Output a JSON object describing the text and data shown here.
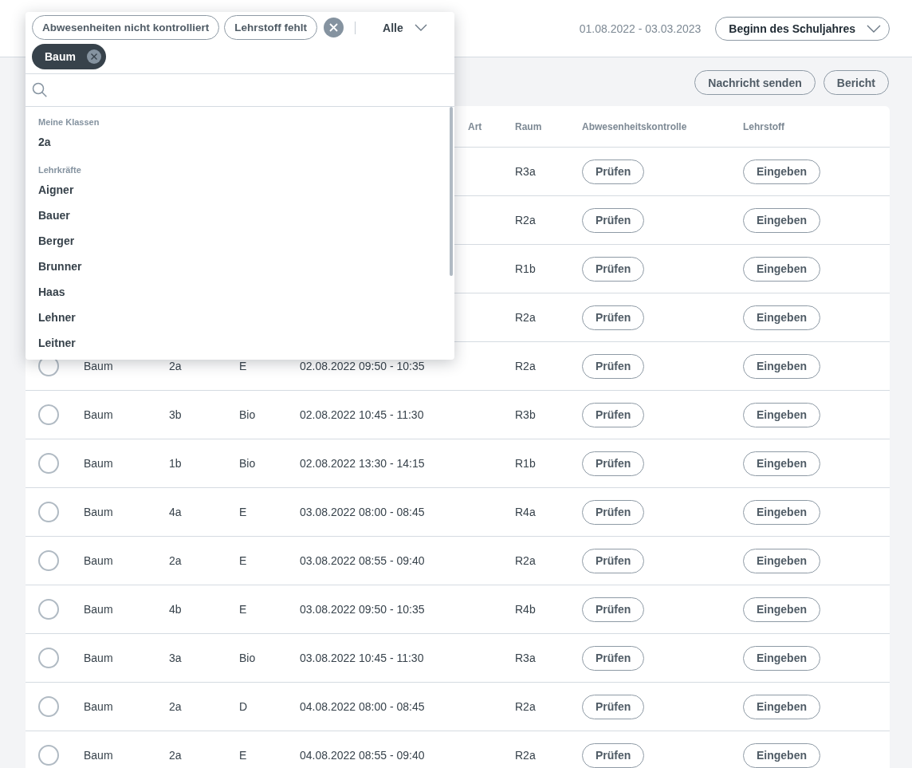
{
  "header": {
    "date_range": "01.08.2022 - 03.03.2023",
    "period_select": "Beginn des Schuljahres"
  },
  "actions": [
    "Nachricht senden",
    "Bericht"
  ],
  "filter_popup": {
    "chips": [
      {
        "label": "Abwesenheiten nicht kontrolliert",
        "selected": false
      },
      {
        "label": "Lehrstoff fehlt",
        "selected": false
      }
    ],
    "scope_select": "Alle",
    "tags": [
      {
        "label": "Baum"
      }
    ],
    "groups": [
      {
        "heading": "Meine Klassen",
        "items": [
          "2a"
        ]
      },
      {
        "heading": "Lehrkräfte",
        "items": [
          "Aigner",
          "Bauer",
          "Berger",
          "Brunner",
          "Haas",
          "Lehner",
          "Leitner"
        ]
      }
    ]
  },
  "table": {
    "columns": [
      null,
      null,
      null,
      null,
      null,
      "Art",
      "Raum",
      "Abwesenheitskontrolle",
      "Lehrstoff"
    ],
    "rows": [
      {
        "room": "R3a",
        "check": "Prüfen",
        "topic": "Eingeben"
      },
      {
        "room": "R2a",
        "check": "Prüfen",
        "topic": "Eingeben"
      },
      {
        "room": "R1b",
        "check": "Prüfen",
        "topic": "Eingeben"
      },
      {
        "room": "R2a",
        "check": "Prüfen",
        "topic": "Eingeben"
      },
      {
        "selected": false,
        "teacher": "Baum",
        "class": "2a",
        "subject": "E",
        "time": "02.08.2022 09:50 - 10:35",
        "room": "R2a",
        "check": "Prüfen",
        "topic": "Eingeben"
      },
      {
        "selected": false,
        "teacher": "Baum",
        "class": "3b",
        "subject": "Bio",
        "time": "02.08.2022 10:45 - 11:30",
        "room": "R3b",
        "check": "Prüfen",
        "topic": "Eingeben"
      },
      {
        "selected": false,
        "teacher": "Baum",
        "class": "1b",
        "subject": "Bio",
        "time": "02.08.2022 13:30 - 14:15",
        "room": "R1b",
        "check": "Prüfen",
        "topic": "Eingeben"
      },
      {
        "selected": false,
        "teacher": "Baum",
        "class": "4a",
        "subject": "E",
        "time": "03.08.2022 08:00 - 08:45",
        "room": "R4a",
        "check": "Prüfen",
        "topic": "Eingeben"
      },
      {
        "selected": false,
        "teacher": "Baum",
        "class": "2a",
        "subject": "E",
        "time": "03.08.2022 08:55 - 09:40",
        "room": "R2a",
        "check": "Prüfen",
        "topic": "Eingeben"
      },
      {
        "selected": false,
        "teacher": "Baum",
        "class": "4b",
        "subject": "E",
        "time": "03.08.2022 09:50 - 10:35",
        "room": "R4b",
        "check": "Prüfen",
        "topic": "Eingeben"
      },
      {
        "selected": false,
        "teacher": "Baum",
        "class": "3a",
        "subject": "Bio",
        "time": "03.08.2022 10:45 - 11:30",
        "room": "R3a",
        "check": "Prüfen",
        "topic": "Eingeben"
      },
      {
        "selected": false,
        "teacher": "Baum",
        "class": "2a",
        "subject": "D",
        "time": "04.08.2022 08:00 - 08:45",
        "room": "R2a",
        "check": "Prüfen",
        "topic": "Eingeben"
      },
      {
        "selected": false,
        "teacher": "Baum",
        "class": "2a",
        "subject": "E",
        "time": "04.08.2022 08:55 - 09:40",
        "room": "R2a",
        "check": "Prüfen",
        "topic": "Eingeben"
      }
    ]
  }
}
